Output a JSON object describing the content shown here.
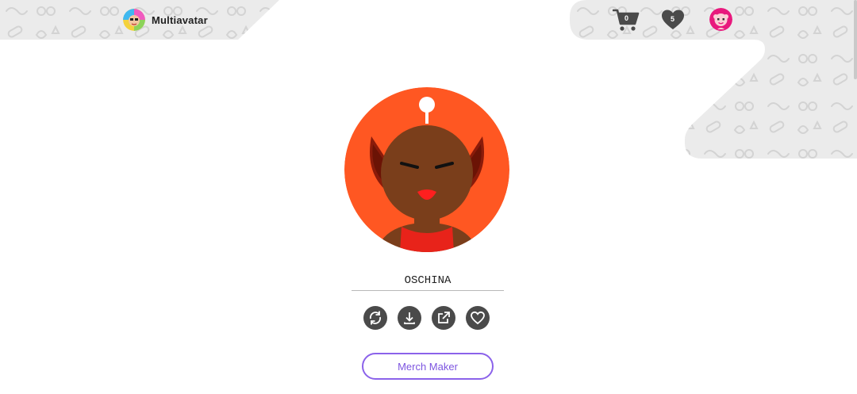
{
  "header": {
    "brand_name": "Multiavatar",
    "brand_logo_icon": "multiavatar-logo-icon",
    "cart": {
      "icon": "cart-icon",
      "count": "0"
    },
    "favorites": {
      "icon": "heart-icon",
      "count": "5"
    },
    "profile": {
      "icon": "profile-avatar-icon"
    }
  },
  "main": {
    "avatar_icon": "avatar-image",
    "name_value": "OSCHINA",
    "actions": [
      {
        "icon": "refresh-icon"
      },
      {
        "icon": "download-icon"
      },
      {
        "icon": "external-link-icon"
      },
      {
        "icon": "heart-outline-icon"
      }
    ],
    "merch_label": "Merch Maker"
  },
  "colors": {
    "background": "#ffffff",
    "pattern_bg": "#ebebeb",
    "icon_dark": "#4a4a4a",
    "accent_purple": "#8b62ea",
    "avatar_bg": "#ff5722",
    "avatar_skin": "#7a3e1b"
  }
}
